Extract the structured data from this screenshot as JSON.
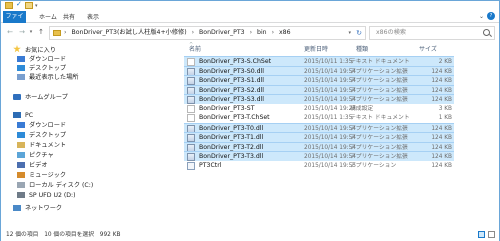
{
  "ribbon": {
    "tabs": {
      "file": "ファイル",
      "home": "ホーム",
      "share": "共有",
      "view": "表示"
    },
    "expand_icon": "chevron-down-icon",
    "help_label": "?"
  },
  "titlebar": {
    "sep_glyph": "▾"
  },
  "nav": {
    "back": "←",
    "forward": "→",
    "dropdown": "▾",
    "up": "↑"
  },
  "address": {
    "crumbs": [
      "BonDriver_PT3(お試し人柱版4+小修修)",
      "BonDriver_PT3",
      "bin",
      "x86"
    ],
    "separator": "›",
    "dropdown": "▾",
    "refresh": "↻"
  },
  "search": {
    "placeholder": "x86の検索"
  },
  "sidebar": {
    "items": [
      {
        "label": "お気に入り",
        "icon": "star-icon"
      },
      {
        "label": "ダウンロード",
        "icon": "download-icon"
      },
      {
        "label": "デスクトップ",
        "icon": "desktop-icon"
      },
      {
        "label": "最近表示した場所",
        "icon": "recent-places-icon"
      },
      {
        "label": "ホームグループ",
        "icon": "homegroup-icon"
      },
      {
        "label": "PC",
        "icon": "pc-icon"
      },
      {
        "label": "ダウンロード",
        "icon": "download-icon"
      },
      {
        "label": "デスクトップ",
        "icon": "desktop-icon"
      },
      {
        "label": "ドキュメント",
        "icon": "documents-icon"
      },
      {
        "label": "ピクチャ",
        "icon": "pictures-icon"
      },
      {
        "label": "ビデオ",
        "icon": "videos-icon"
      },
      {
        "label": "ミュージック",
        "icon": "music-icon"
      },
      {
        "label": "ローカル ディスク (C:)",
        "icon": "drive-icon"
      },
      {
        "label": "SP UFD U2 (D:)",
        "icon": "usb-drive-icon"
      },
      {
        "label": "ネットワーク",
        "icon": "network-icon"
      }
    ]
  },
  "columns": {
    "name": "名前",
    "date": "更新日時",
    "type": "種類",
    "size": "サイズ",
    "sort_glyph": "^"
  },
  "files": [
    {
      "name": "BonDriver_PT3-S.ChSet",
      "date": "2015/10/11 1:35",
      "type": "テキスト ドキュメント",
      "size": "2 KB",
      "selected": true,
      "icon": "text-file-icon"
    },
    {
      "name": "BonDriver_PT3-S0.dll",
      "date": "2015/10/14 19:54",
      "type": "アプリケーション拡張",
      "size": "124 KB",
      "selected": true,
      "icon": "dll-file-icon"
    },
    {
      "name": "BonDriver_PT3-S1.dll",
      "date": "2015/10/14 19:54",
      "type": "アプリケーション拡張",
      "size": "124 KB",
      "selected": true,
      "icon": "dll-file-icon"
    },
    {
      "name": "BonDriver_PT3-S2.dll",
      "date": "2015/10/14 19:54",
      "type": "アプリケーション拡張",
      "size": "124 KB",
      "selected": true,
      "icon": "dll-file-icon"
    },
    {
      "name": "BonDriver_PT3-S3.dll",
      "date": "2015/10/14 19:54",
      "type": "アプリケーション拡張",
      "size": "124 KB",
      "selected": true,
      "icon": "dll-file-icon"
    },
    {
      "name": "BonDriver_PT3-ST",
      "date": "2015/10/14 19:27",
      "type": "構成設定",
      "size": "3 KB",
      "selected": false,
      "icon": "settings-file-icon"
    },
    {
      "name": "BonDriver_PT3-T.ChSet",
      "date": "2015/10/11 1:35",
      "type": "テキスト ドキュメント",
      "size": "1 KB",
      "selected": false,
      "icon": "text-file-icon"
    },
    {
      "name": "BonDriver_PT3-T0.dll",
      "date": "2015/10/14 19:54",
      "type": "アプリケーション拡張",
      "size": "124 KB",
      "selected": true,
      "icon": "dll-file-icon"
    },
    {
      "name": "BonDriver_PT3-T1.dll",
      "date": "2015/10/14 19:54",
      "type": "アプリケーション拡張",
      "size": "124 KB",
      "selected": true,
      "icon": "dll-file-icon"
    },
    {
      "name": "BonDriver_PT3-T2.dll",
      "date": "2015/10/14 19:54",
      "type": "アプリケーション拡張",
      "size": "124 KB",
      "selected": true,
      "icon": "dll-file-icon"
    },
    {
      "name": "BonDriver_PT3-T3.dll",
      "date": "2015/10/14 19:54",
      "type": "アプリケーション拡張",
      "size": "124 KB",
      "selected": true,
      "icon": "dll-file-icon"
    },
    {
      "name": "PT3Ctrl",
      "date": "2015/10/14 19:55",
      "type": "アプリケーション",
      "size": "124 KB",
      "selected": false,
      "icon": "exe-file-icon"
    }
  ],
  "status": {
    "text": "12 個の項目　10 個の項目を選択　992 KB"
  },
  "colors": {
    "accent": "#1979ca",
    "selection": "#cde8fb",
    "selection_border": "#a6d0f3"
  }
}
